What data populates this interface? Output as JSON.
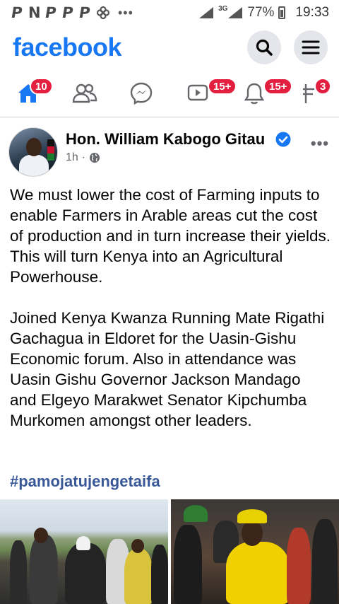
{
  "status_bar": {
    "app_icons": [
      "P",
      "N",
      "P",
      "P",
      "P"
    ],
    "more_dots": "•••",
    "network": "3G",
    "battery": "77%",
    "time": "19:33"
  },
  "header": {
    "logo": "facebook",
    "search_icon": "search-icon",
    "menu_icon": "hamburger-menu-icon"
  },
  "nav": {
    "tabs": [
      {
        "name": "home",
        "icon": "home-icon",
        "badge": "10",
        "active": true
      },
      {
        "name": "friends",
        "icon": "friends-icon",
        "badge": ""
      },
      {
        "name": "messenger",
        "icon": "messenger-icon",
        "badge": ""
      },
      {
        "name": "watch",
        "icon": "watch-icon",
        "badge": "15+"
      },
      {
        "name": "notifications",
        "icon": "bell-icon",
        "badge": "15+"
      },
      {
        "name": "marketplace",
        "icon": "flag-icon",
        "badge": "3"
      }
    ]
  },
  "post": {
    "author": "Hon. William Kabogo Gitau",
    "verified": true,
    "time": "1h",
    "privacy_icon": "globe-icon",
    "more": "•••",
    "paragraph_1": "We must lower the cost of Farming inputs to enable Farmers in Arable areas cut the cost of production and in turn increase their yields. This will turn Kenya into an Agricultural Powerhouse.",
    "paragraph_2": "Joined Kenya Kwanza Running Mate Rigathi Gachagua in Eldoret for the Uasin-Gishu Economic forum. Also in attendance was Uasin Gishu Governor Jackson Mandago and Elgeyo Marakwet Senator Kipchumba Murkomen amongst other leaders.",
    "hashtag": "#pamojatujengetaifa"
  },
  "colors": {
    "brand": "#1877f2",
    "badge": "#e41e3f",
    "hashtag": "#385898",
    "secondary_text": "#65676b"
  }
}
